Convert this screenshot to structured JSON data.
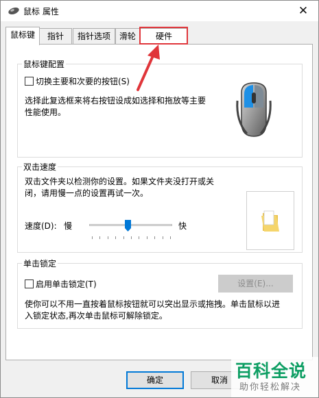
{
  "window": {
    "title": "鼠标 属性",
    "close": "✕"
  },
  "tabs": [
    {
      "label": "鼠标键",
      "active": true
    },
    {
      "label": "指针"
    },
    {
      "label": "指针选项"
    },
    {
      "label": "滑轮"
    },
    {
      "label": "硬件",
      "highlighted": true
    }
  ],
  "button_config": {
    "title": "鼠标键配置",
    "switch_checkbox": {
      "label": "切换主要和次要的按钮(S)",
      "checked": false
    },
    "description_line1": "选择此复选框来将右按钮设成如选择和拖放等主要",
    "description_line2": "性能使用。"
  },
  "double_click": {
    "title": "双击速度",
    "description_line1": "双击文件夹以检测你的设置。如果文件夹没打开或关",
    "description_line2": "闭，请用慢一点的设置再试一次。",
    "speed_label": "速度(D):",
    "slow_label": "慢",
    "fast_label": "快",
    "speed_value_fraction": 0.46,
    "tick_count": 11
  },
  "click_lock": {
    "title": "单击锁定",
    "enable_checkbox": {
      "label": "启用单击锁定(T)",
      "checked": false
    },
    "settings_button": "设置(E)...",
    "description_line1": "使你可以不用一直按着鼠标按钮就可以突出显示或拖拽。单击鼠标以进",
    "description_line2": "入锁定状态,再次单击鼠标可解除锁定。"
  },
  "footer": {
    "ok_label": "确定",
    "cancel_label": "取消"
  },
  "watermark": {
    "title": "百科全说",
    "subtitle": "助你轻松解决"
  },
  "colors": {
    "accent": "#0078d7",
    "highlight_box": "#e0353a",
    "mouse_button_blue": "#1e90e6",
    "watermark_green": "#0d9e63",
    "folder_yellow": "#f5d56b"
  }
}
